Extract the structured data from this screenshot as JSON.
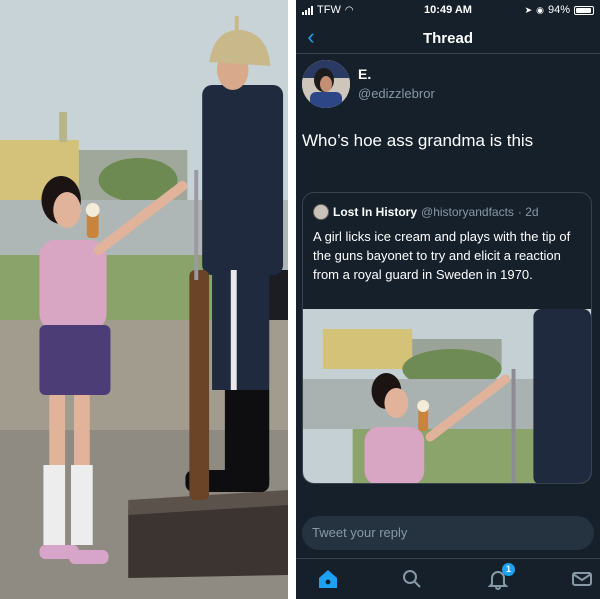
{
  "status_bar": {
    "carrier": "TFW",
    "time": "10:49 AM",
    "battery": "94%"
  },
  "nav": {
    "title": "Thread",
    "back_icon": "chevron-left-icon"
  },
  "tweet": {
    "author_name": "E.",
    "author_handle": "@edizzlebror",
    "text": "Who’s hoe ass grandma is this"
  },
  "quoted_tweet": {
    "author_name": "Lost In History",
    "author_handle": "@historyandfacts",
    "age": "· 2d",
    "text": "A girl licks ice cream and plays with the tip of the guns bayonet to try and elicit a reaction from a royal guard in Sweden in 1970."
  },
  "reply": {
    "placeholder": "Tweet your reply"
  },
  "tab_bar": {
    "items": [
      "home-icon",
      "search-icon",
      "notifications-icon",
      "messages-icon"
    ],
    "notification_count": "1"
  },
  "colors": {
    "background": "#15202b",
    "accent": "#1da1f2",
    "muted_text": "#8899a6",
    "border": "#38444d"
  }
}
